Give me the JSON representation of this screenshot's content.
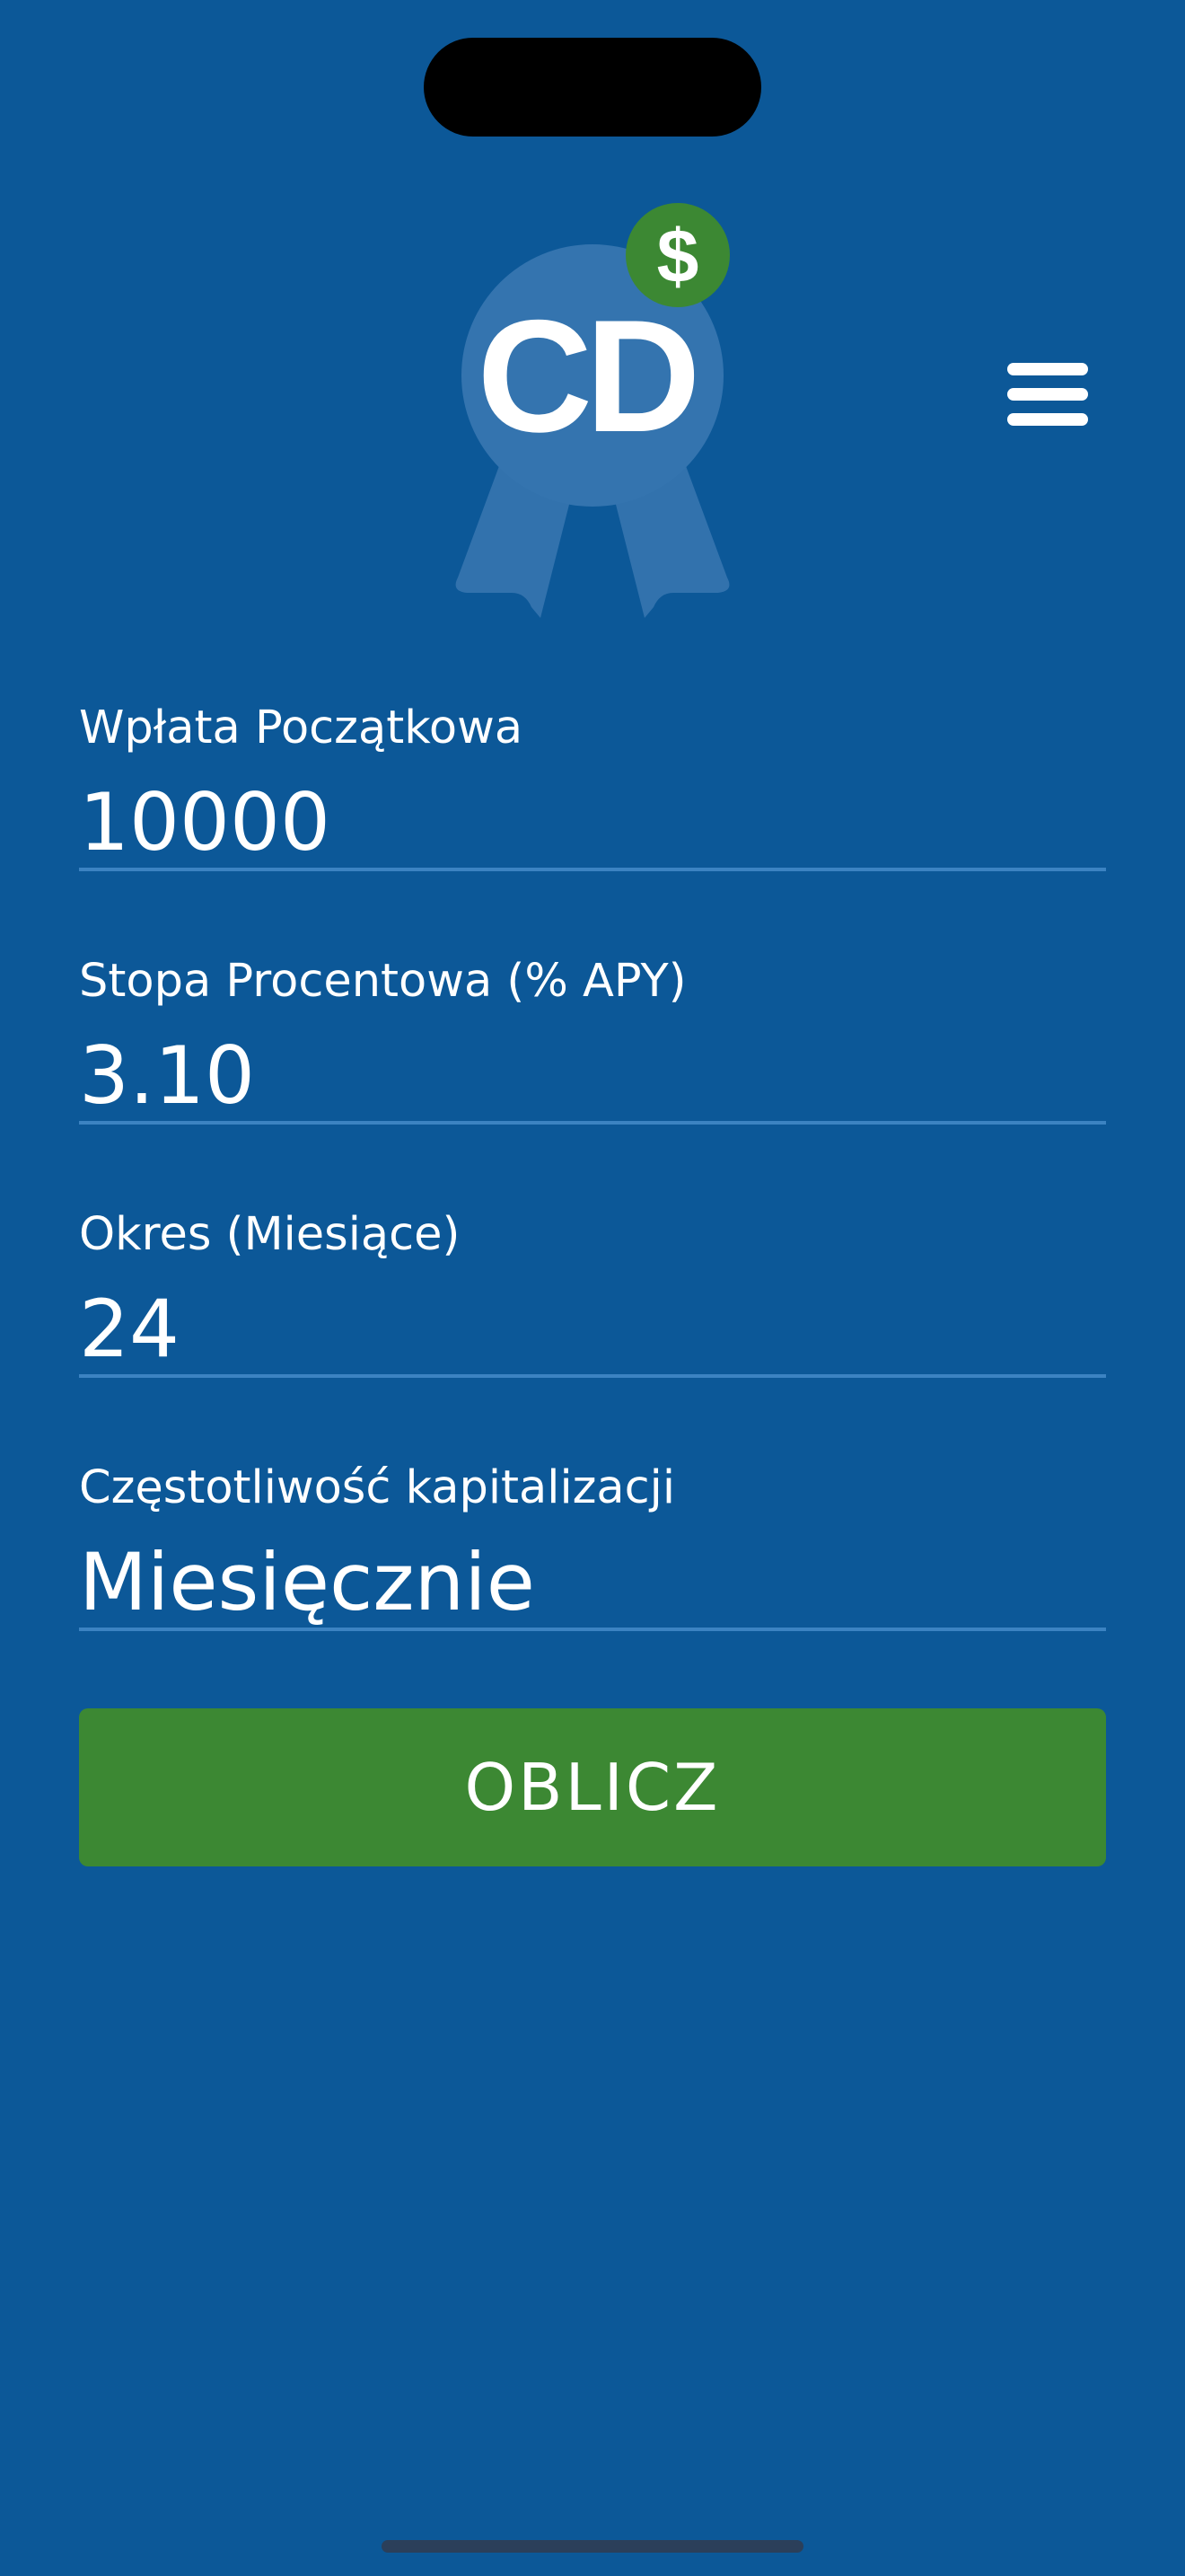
{
  "app": {
    "logo_text": "CD",
    "badge_symbol": "$"
  },
  "menu": {
    "icon": "hamburger-menu-icon"
  },
  "form": {
    "fields": [
      {
        "label": "Wpłata Początkowa",
        "value": "10000"
      },
      {
        "label": "Stopa Procentowa (% APY)",
        "value": "3.10"
      },
      {
        "label": "Okres (Miesiące)",
        "value": "24"
      },
      {
        "label": "Częstotliwość kapitalizacji",
        "value": "Miesięcznie"
      }
    ],
    "submit_label": "OBLICZ"
  },
  "colors": {
    "background": "#0c5898",
    "accent_green": "#3c8833",
    "underline": "#3c83c2",
    "logo_circle": "#3474af"
  }
}
